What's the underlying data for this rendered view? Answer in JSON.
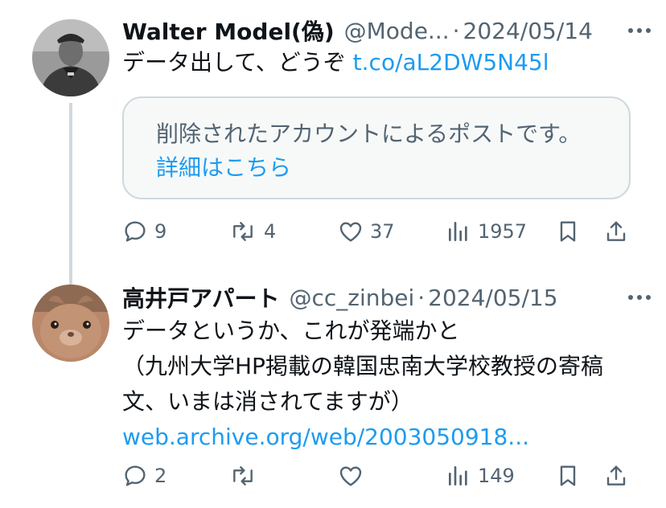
{
  "tweets": [
    {
      "author_name": "Walter Model(偽)",
      "handle": "@Mode...",
      "separator": "·",
      "date": "2024/05/14",
      "text": "データ出して、どうぞ ",
      "link": "t.co/aL2DW5N45l",
      "avatar_icon": "avatar-officer-photo",
      "deleted_notice": {
        "text": "削除されたアカウントによるポストです。",
        "link": "詳細はこちら"
      },
      "stats": {
        "replies": "9",
        "reposts": "4",
        "likes": "37",
        "views": "1957"
      }
    },
    {
      "author_name": "高井戸アパート",
      "handle": "@cc_zinbei",
      "separator": "·",
      "date": "2024/05/15",
      "text": "データというか、これが発端かと\n（九州大学HP掲載の韓国忠南大学校教授の寄稿文、いまは消されてますが）",
      "link": "web.archive.org/web/2003050918...",
      "avatar_icon": "avatar-rabbit-photo",
      "stats": {
        "replies": "2",
        "reposts": "",
        "likes": "",
        "views": "149"
      }
    }
  ],
  "icons": {
    "reply": "reply-icon",
    "repost": "repost-icon",
    "like": "like-icon",
    "views": "views-icon",
    "bookmark": "bookmark-icon",
    "share": "share-icon",
    "more": "more-icon"
  },
  "colors": {
    "text": "#0f1419",
    "secondary": "#536471",
    "link": "#1d9bf0",
    "border": "#cfd9de",
    "card_bg": "#f7f9f9"
  }
}
